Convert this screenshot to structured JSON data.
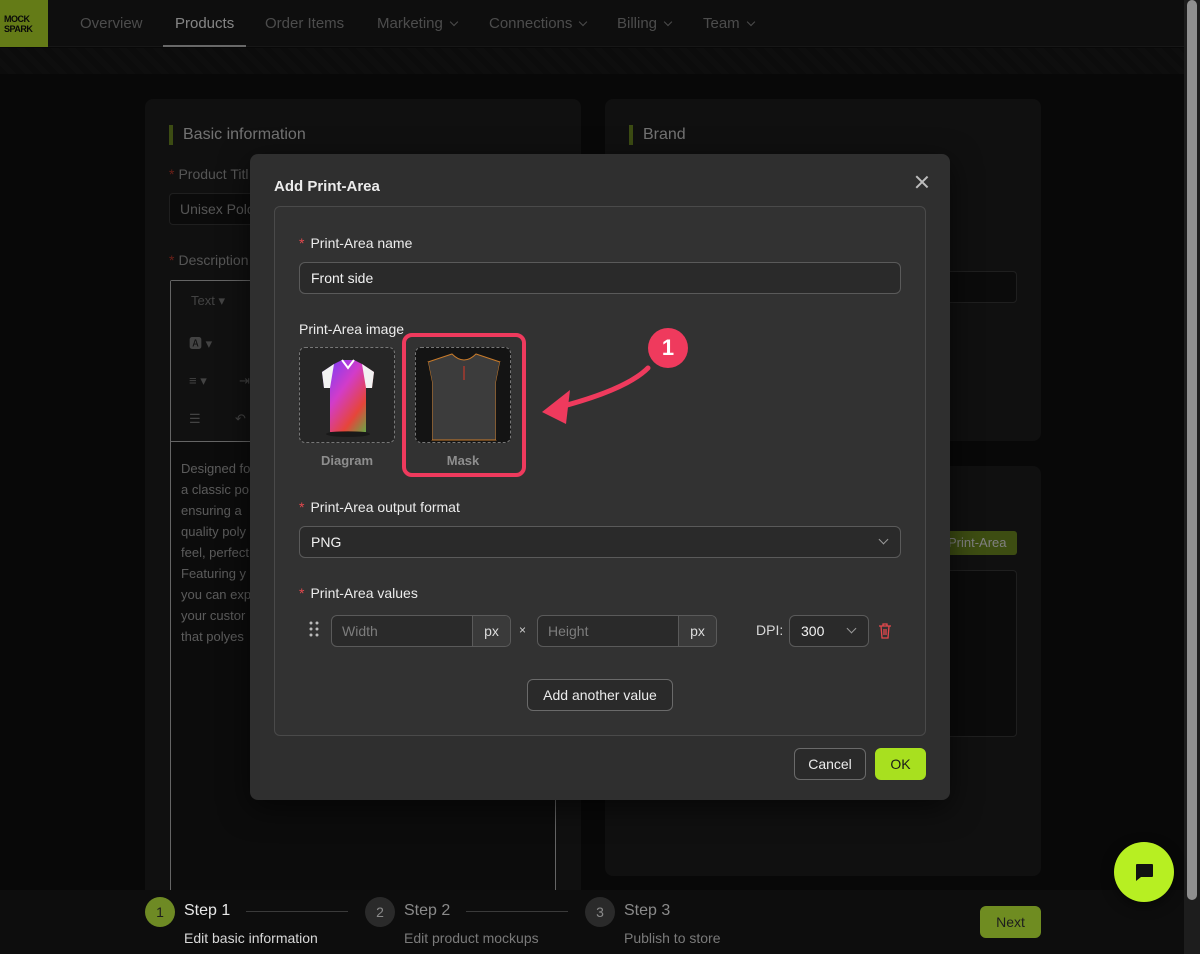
{
  "nav": {
    "logo_text": "MOCK SPARK",
    "items": [
      {
        "label": "Overview"
      },
      {
        "label": "Products"
      },
      {
        "label": "Order Items"
      },
      {
        "label": "Marketing"
      },
      {
        "label": "Connections"
      },
      {
        "label": "Billing"
      },
      {
        "label": "Team"
      }
    ]
  },
  "background": {
    "basic_info": {
      "title": "Basic information",
      "product_title_label": "Product Titl",
      "product_title_value": "Unisex Polo",
      "description_label": "Description",
      "toolbar_text": "Text",
      "description_lines": [
        "Designed fo",
        "a classic po",
        "ensuring a",
        "quality poly",
        "feel, perfect",
        "Featuring y",
        "you can exp",
        "your custor",
        "that polyes"
      ]
    },
    "brand": {
      "title": "Brand"
    },
    "print_area_chip": "Print-Area"
  },
  "modal": {
    "title": "Add Print-Area",
    "name_label": "Print-Area name",
    "name_value": "Front side",
    "image_label": "Print-Area image",
    "images": [
      {
        "caption": "Diagram"
      },
      {
        "caption": "Mask"
      }
    ],
    "format_label": "Print-Area output format",
    "format_value": "PNG",
    "values_label": "Print-Area values",
    "width_placeholder": "Width",
    "height_placeholder": "Height",
    "unit": "px",
    "times": "×",
    "dpi_label": "DPI:",
    "dpi_value": "300",
    "add_value_button": "Add another value",
    "cancel_button": "Cancel",
    "ok_button": "OK"
  },
  "annotation": {
    "badge_number": "1",
    "color": "#ef3a5d"
  },
  "stepper": {
    "steps": [
      {
        "number": "1",
        "title": "Step 1",
        "description": "Edit basic information",
        "state": "active"
      },
      {
        "number": "2",
        "title": "Step 2",
        "description": "Edit product mockups",
        "state": "pending"
      },
      {
        "number": "3",
        "title": "Step 3",
        "description": "Publish to store",
        "state": "pending"
      }
    ],
    "next_button": "Next"
  },
  "colors": {
    "accent": "#a8e01f",
    "required": "#e5484d",
    "delete": "#e5484d"
  }
}
